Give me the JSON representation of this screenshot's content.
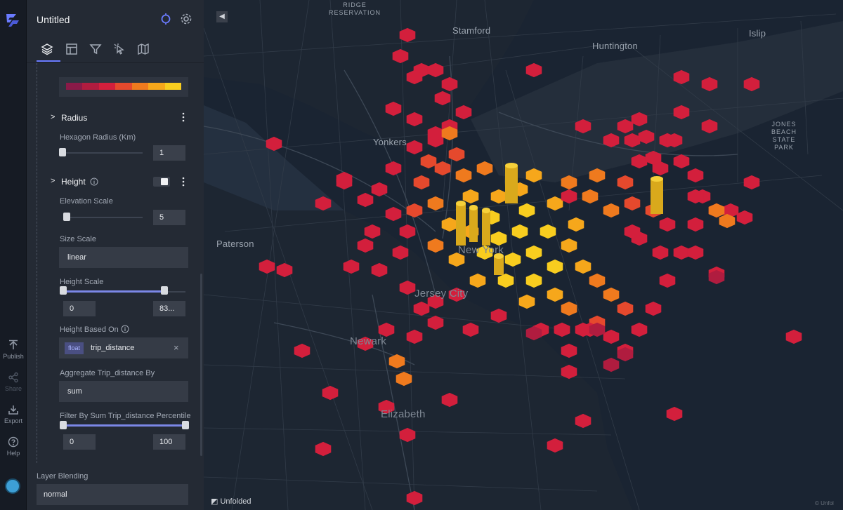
{
  "app": {
    "title": "Untitled",
    "brand": "Unfolded",
    "attribution": "© Unfol"
  },
  "rail": {
    "publish": "Publish",
    "share": "Share",
    "export": "Export",
    "help": "Help"
  },
  "icons": {
    "sync": "sync-icon",
    "settings": "gear-icon",
    "tabs": [
      "layers-icon",
      "layout-icon",
      "filter-icon",
      "interaction-icon",
      "map-icon"
    ]
  },
  "colors": {
    "accent": "#6a7bff",
    "ramp": [
      "#8a1a48",
      "#b01c3f",
      "#d31f3c",
      "#e5492d",
      "#ef7a1e",
      "#f6a71b",
      "#f8cd1f"
    ]
  },
  "radius": {
    "header": "Radius",
    "hex_label": "Hexagon Radius (Km)",
    "hex_value": "1"
  },
  "height": {
    "header": "Height",
    "enabled": true,
    "elevation_label": "Elevation Scale",
    "elevation_value": "5",
    "size_scale_label": "Size Scale",
    "size_scale_value": "linear",
    "height_scale_label": "Height Scale",
    "height_scale_min": "0",
    "height_scale_max": "83...",
    "based_on_label": "Height Based On",
    "field_type": "float",
    "field_name": "trip_distance",
    "aggregate_label": "Aggregate Trip_distance By",
    "aggregate_value": "sum",
    "filter_label": "Filter By Sum Trip_distance Percentile",
    "filter_min": "0",
    "filter_max": "100"
  },
  "blending": {
    "label": "Layer Blending",
    "value": "normal"
  },
  "map_labels": {
    "ridge": "RIDGE\nRESERVATION",
    "stamford": "Stamford",
    "islip": "Islip",
    "huntington": "Huntington",
    "jones_beach": "JONES\nBEACH\nSTATE\nPARK",
    "yonkers": "Yonkers",
    "paterson": "Paterson",
    "new_york": "New York",
    "jersey_city": "Jersey City",
    "newark": "Newark",
    "elizabeth": "Elizabeth"
  }
}
